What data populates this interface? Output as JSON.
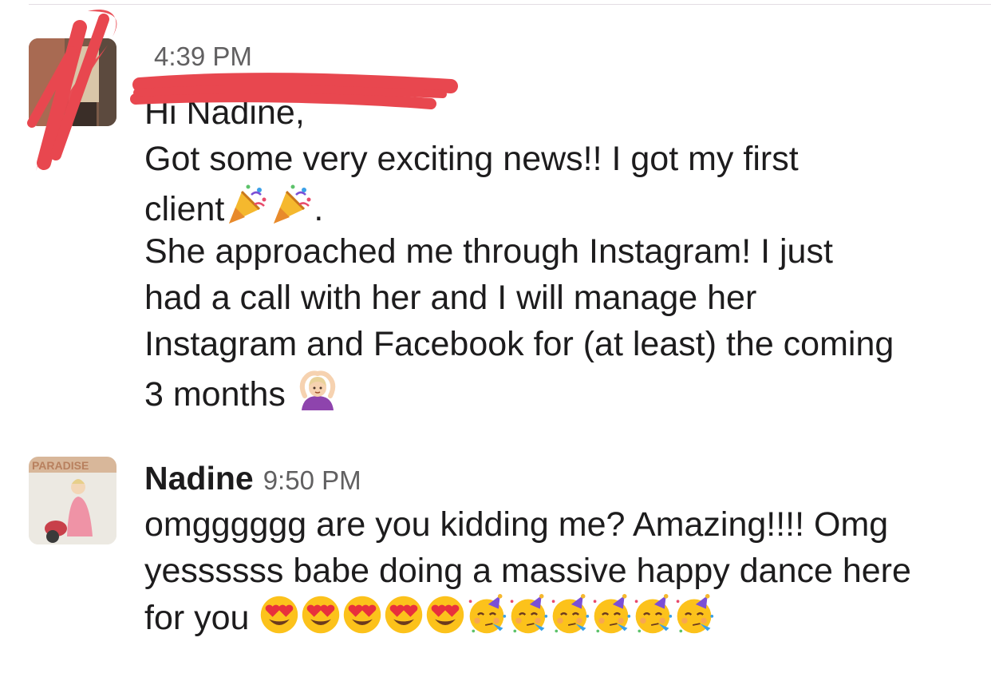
{
  "messages": [
    {
      "sender": "",
      "time": "4:39 PM",
      "lines": [
        "Hi Nadine,",
        "Got some very exciting news!! I got my first",
        "client",
        ".",
        "She approached me through Instagram! I just",
        "had a call with her and I will manage her",
        "Instagram and Facebook for (at least) the coming",
        "3 months"
      ],
      "emoji": [
        "party-popper-icon",
        "party-popper-icon",
        "person-gesturing-ok-icon"
      ],
      "redacted": true
    },
    {
      "sender": "Nadine",
      "time": "9:50 PM",
      "lines": [
        "omgggggg are you kidding me? Amazing!!!! Omg",
        "yessssss babe doing a massive happy dance here",
        "for you"
      ],
      "emoji": [
        "heart-eyes-icon",
        "heart-eyes-icon",
        "heart-eyes-icon",
        "heart-eyes-icon",
        "heart-eyes-icon",
        "partying-face-icon",
        "partying-face-icon",
        "partying-face-icon",
        "partying-face-icon",
        "partying-face-icon",
        "partying-face-icon"
      ]
    }
  ],
  "colors": {
    "text": "#1d1c1d",
    "timestamp": "#616061",
    "redaction": "#e8474f"
  }
}
